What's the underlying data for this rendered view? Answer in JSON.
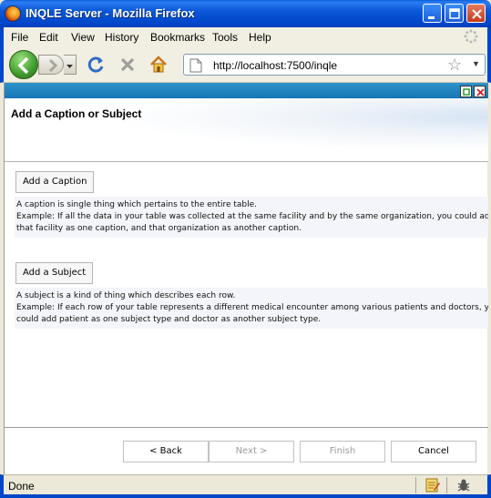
{
  "window": {
    "title": "INQLE Server - Mozilla Firefox",
    "icon": "firefox-icon",
    "controls": [
      "minimize-icon",
      "maximize-icon",
      "close-icon"
    ]
  },
  "menu": {
    "items": [
      "File",
      "Edit",
      "View",
      "History",
      "Bookmarks",
      "Tools",
      "Help"
    ]
  },
  "toolbar": {
    "url": "http://localhost:7500/inqle",
    "icons": [
      "back-arrow-icon",
      "forward-arrow-icon",
      "reload-icon",
      "stop-icon",
      "home-icon",
      "bookmark-star-icon"
    ]
  },
  "page": {
    "title": "Add a Caption or Subject",
    "caption_button": "Add a Caption",
    "caption_desc": [
      "A caption is single thing which pertains to the entire table.",
      "Example: If all the data in your table was collected at the same facility and by the same organization, you could add",
      "that facility as one caption, and that organization as another caption."
    ],
    "subject_button": "Add a Subject",
    "subject_desc": [
      "A subject is a kind of thing which describes each row.",
      "Example: If each row of your table represents a different medical encounter among various patients and doctors, you",
      "could add patient as one subject type and doctor as another subject type."
    ]
  },
  "wizard": {
    "back": "< Back",
    "next": "Next >",
    "finish": "Finish",
    "cancel": "Cancel"
  },
  "status": {
    "text": "Done"
  },
  "colors": {
    "xp_blue": "#0047C9",
    "panel_bar": "#1676B5",
    "back_green": "#3E9B2B"
  }
}
